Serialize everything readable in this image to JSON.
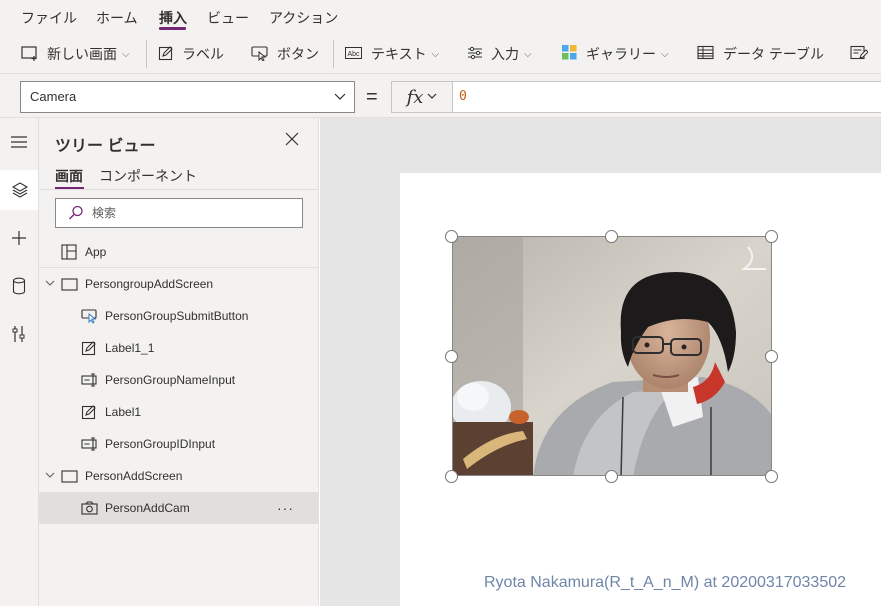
{
  "menu": {
    "items": [
      "ファイル",
      "ホーム",
      "挿入",
      "ビュー",
      "アクション"
    ],
    "active": "挿入"
  },
  "toolbar": {
    "new_screen": "新しい画面",
    "label": "ラベル",
    "button": "ボタン",
    "text": "テキスト",
    "input": "入力",
    "gallery": "ギャラリー",
    "data_table": "データ テーブル"
  },
  "formula": {
    "property": "Camera",
    "equals": "=",
    "fx": "fx",
    "value": "0"
  },
  "tree": {
    "title": "ツリー ビュー",
    "tabs": [
      "画面",
      "コンポーネント"
    ],
    "search_placeholder": "検索",
    "app_label": "App",
    "items": [
      {
        "label": "PersongroupAddScreen"
      },
      {
        "label": "PersonGroupSubmitButton"
      },
      {
        "label": "Label1_1"
      },
      {
        "label": "PersonGroupNameInput"
      },
      {
        "label": "Label1"
      },
      {
        "label": "PersonGroupIDInput"
      },
      {
        "label": "PersonAddScreen"
      },
      {
        "label": "PersonAddCam"
      }
    ],
    "more": "···"
  },
  "watermark": "Ryota Nakamura(R_t_A_n_M) at 20200317033502",
  "colors": {
    "accent": "#742774",
    "formula_value": "#c55a11",
    "watermark": "#6f86a8"
  }
}
